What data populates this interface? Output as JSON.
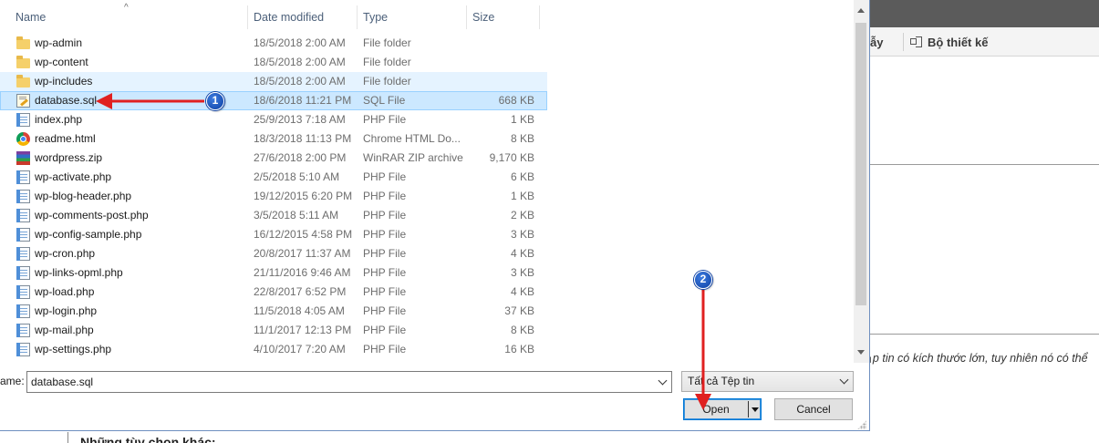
{
  "background": {
    "tab_1_label": "ẫy",
    "tab_2_label": "Bộ thiết kế",
    "notice_text": "p tin có kích thước lớn, tuy nhiên nó có thể",
    "options_heading": "Những tùy chọn khác:"
  },
  "dialog": {
    "columns": {
      "name": "Name",
      "date": "Date modified",
      "type": "Type",
      "size": "Size"
    },
    "files": [
      {
        "name": "wp-admin",
        "date": "18/5/2018 2:00 AM",
        "type": "File folder",
        "size": "",
        "icon": "folder-icon"
      },
      {
        "name": "wp-content",
        "date": "18/5/2018 2:00 AM",
        "type": "File folder",
        "size": "",
        "icon": "folder-icon"
      },
      {
        "name": "wp-includes",
        "date": "18/5/2018 2:00 AM",
        "type": "File folder",
        "size": "",
        "icon": "folder-icon"
      },
      {
        "name": "database.sql",
        "date": "18/6/2018 11:21 PM",
        "type": "SQL File",
        "size": "668 KB",
        "icon": "sql-file-icon"
      },
      {
        "name": "index.php",
        "date": "25/9/2013 7:18 AM",
        "type": "PHP File",
        "size": "1 KB",
        "icon": "php-file-icon"
      },
      {
        "name": "readme.html",
        "date": "18/3/2018 11:13 PM",
        "type": "Chrome HTML Do...",
        "size": "8 KB",
        "icon": "chrome-html-icon"
      },
      {
        "name": "wordpress.zip",
        "date": "27/6/2018 2:00 PM",
        "type": "WinRAR ZIP archive",
        "size": "9,170 KB",
        "icon": "winrar-zip-icon"
      },
      {
        "name": "wp-activate.php",
        "date": "2/5/2018 5:10 AM",
        "type": "PHP File",
        "size": "6 KB",
        "icon": "php-file-icon"
      },
      {
        "name": "wp-blog-header.php",
        "date": "19/12/2015 6:20 PM",
        "type": "PHP File",
        "size": "1 KB",
        "icon": "php-file-icon"
      },
      {
        "name": "wp-comments-post.php",
        "date": "3/5/2018 5:11 AM",
        "type": "PHP File",
        "size": "2 KB",
        "icon": "php-file-icon"
      },
      {
        "name": "wp-config-sample.php",
        "date": "16/12/2015 4:58 PM",
        "type": "PHP File",
        "size": "3 KB",
        "icon": "php-file-icon"
      },
      {
        "name": "wp-cron.php",
        "date": "20/8/2017 11:37 AM",
        "type": "PHP File",
        "size": "4 KB",
        "icon": "php-file-icon"
      },
      {
        "name": "wp-links-opml.php",
        "date": "21/11/2016 9:46 AM",
        "type": "PHP File",
        "size": "3 KB",
        "icon": "php-file-icon"
      },
      {
        "name": "wp-load.php",
        "date": "22/8/2017 6:52 PM",
        "type": "PHP File",
        "size": "4 KB",
        "icon": "php-file-icon"
      },
      {
        "name": "wp-login.php",
        "date": "11/5/2018 4:05 AM",
        "type": "PHP File",
        "size": "37 KB",
        "icon": "php-file-icon"
      },
      {
        "name": "wp-mail.php",
        "date": "11/1/2017 12:13 PM",
        "type": "PHP File",
        "size": "8 KB",
        "icon": "php-file-icon"
      },
      {
        "name": "wp-settings.php",
        "date": "4/10/2017 7:20 AM",
        "type": "PHP File",
        "size": "16 KB",
        "icon": "php-file-icon"
      }
    ],
    "filename_label": "ame:",
    "filename_value": "database.sql",
    "filetype_value": "Tất cả Tệp tin",
    "open_label": "Open",
    "cancel_label": "Cancel"
  },
  "annotations": {
    "badge_1": "1",
    "badge_2": "2",
    "arrow_color": "#e02020",
    "badge_color": "#1f5fc9"
  }
}
